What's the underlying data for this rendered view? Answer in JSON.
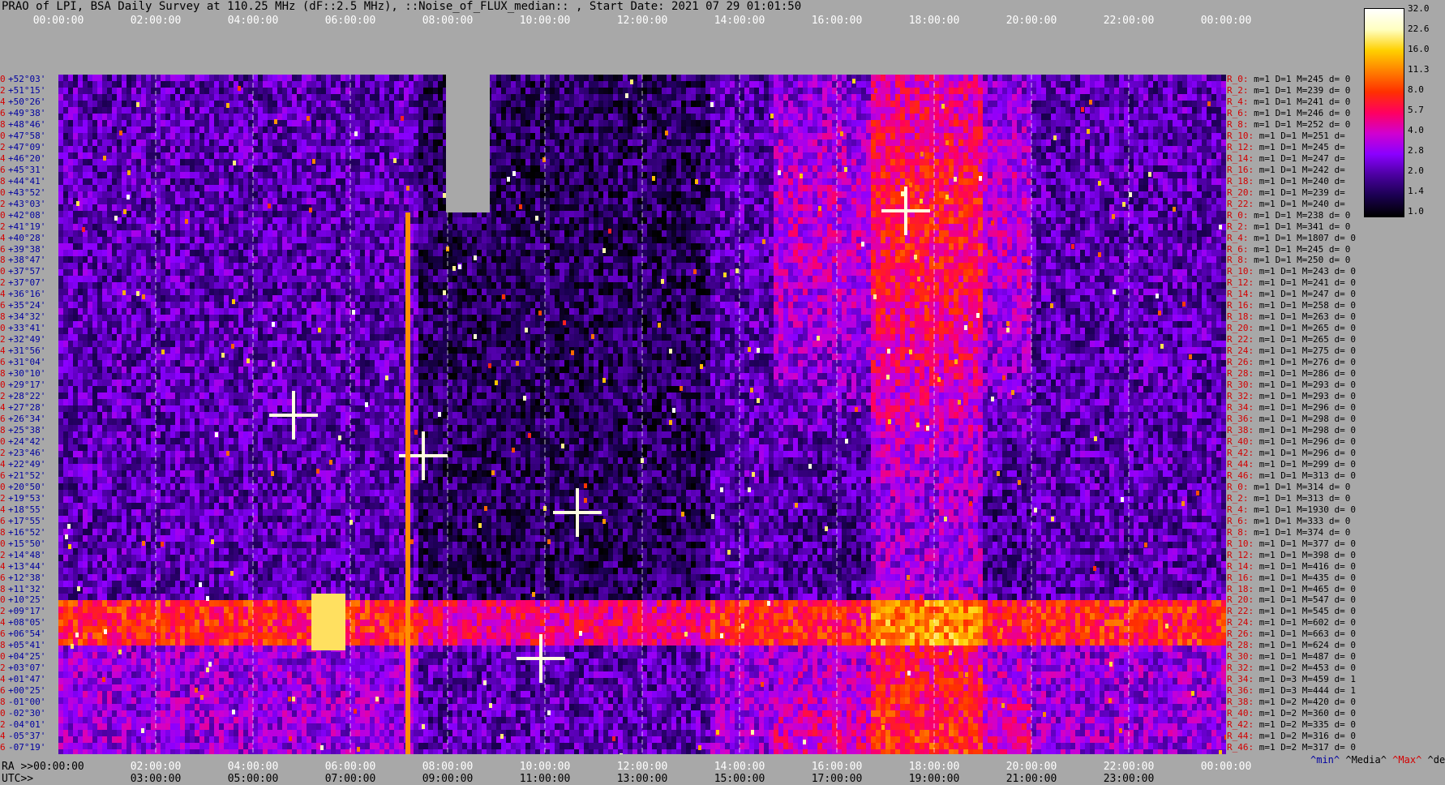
{
  "title": "PRAO of LPI, BSA Daily Survey at 110.25 MHz (dF::2.5 MHz), ::Noise_of_FLUX_median:: , Start Date: 2021 07 29 01:01:50",
  "chart_data": {
    "type": "heatmap",
    "x_top_ticks": [
      "00:00:00",
      "02:00:00",
      "04:00:00",
      "06:00:00",
      "08:00:00",
      "10:00:00",
      "12:00:00",
      "14:00:00",
      "16:00:00",
      "18:00:00",
      "20:00:00",
      "22:00:00",
      "00:00:00"
    ],
    "ra_bottom_ticks": [
      "02:00:00",
      "04:00:00",
      "06:00:00",
      "08:00:00",
      "10:00:00",
      "12:00:00",
      "14:00:00",
      "16:00:00",
      "18:00:00",
      "20:00:00",
      "22:00:00",
      "00:00:00"
    ],
    "ra_first_tick": "00:00:00",
    "utc_ticks": [
      "03:00:00",
      "05:00:00",
      "07:00:00",
      "09:00:00",
      "11:00:00",
      "13:00:00",
      "15:00:00",
      "17:00:00",
      "19:00:00",
      "21:00:00",
      "23:00:00"
    ],
    "ra_axis_label": "RA >>",
    "utc_axis_label": "UTC>>",
    "colorbar_ticks": [
      "32.0",
      "22.6",
      "16.0",
      "11.3",
      "8.0",
      "5.7",
      "4.0",
      "2.8",
      "2.0",
      "1.4",
      "1.0"
    ],
    "colorbar_range": [
      1.0,
      32.0
    ],
    "colorbar_scale": "log",
    "colormap": [
      "#000000",
      "#1a0050",
      "#4b00a0",
      "#8a00ff",
      "#d000d0",
      "#ff0060",
      "#ff3000",
      "#ff8000",
      "#ffd000",
      "#ffffc0",
      "#ffffff"
    ],
    "declinations": [
      {
        "i": "0",
        "d": "+52°03'"
      },
      {
        "i": "2",
        "d": "+51°15'"
      },
      {
        "i": "4",
        "d": "+50°26'"
      },
      {
        "i": "6",
        "d": "+49°38'"
      },
      {
        "i": "8",
        "d": "+48°46'"
      },
      {
        "i": "10",
        "d": "+47°58'"
      },
      {
        "i": "12",
        "d": "+47°09'"
      },
      {
        "i": "14",
        "d": "+46°20'"
      },
      {
        "i": "16",
        "d": "+45°31'"
      },
      {
        "i": "18",
        "d": "+44°41'"
      },
      {
        "i": "20",
        "d": "+43°52'"
      },
      {
        "i": "22",
        "d": "+43°03'"
      },
      {
        "i": "0",
        "d": "+42°08'"
      },
      {
        "i": "2",
        "d": "+41°19'"
      },
      {
        "i": "4",
        "d": "+40°28'"
      },
      {
        "i": "6",
        "d": "+39°38'"
      },
      {
        "i": "8",
        "d": "+38°47'"
      },
      {
        "i": "10",
        "d": "+37°57'"
      },
      {
        "i": "12",
        "d": "+37°07'"
      },
      {
        "i": "14",
        "d": "+36°16'"
      },
      {
        "i": "16",
        "d": "+35°24'"
      },
      {
        "i": "18",
        "d": "+34°32'"
      },
      {
        "i": "20",
        "d": "+33°41'"
      },
      {
        "i": "22",
        "d": "+32°49'"
      },
      {
        "i": "24",
        "d": "+31°56'"
      },
      {
        "i": "26",
        "d": "+31°04'"
      },
      {
        "i": "28",
        "d": "+30°10'"
      },
      {
        "i": "30",
        "d": "+29°17'"
      },
      {
        "i": "32",
        "d": "+28°22'"
      },
      {
        "i": "34",
        "d": "+27°28'"
      },
      {
        "i": "36",
        "d": "+26°34'"
      },
      {
        "i": "38",
        "d": "+25°38'"
      },
      {
        "i": "40",
        "d": "+24°42'"
      },
      {
        "i": "42",
        "d": "+23°46'"
      },
      {
        "i": "44",
        "d": "+22°49'"
      },
      {
        "i": "46",
        "d": "+21°52'"
      },
      {
        "i": "0",
        "d": "+20°50'"
      },
      {
        "i": "2",
        "d": "+19°53'"
      },
      {
        "i": "4",
        "d": "+18°55'"
      },
      {
        "i": "6",
        "d": "+17°55'"
      },
      {
        "i": "8",
        "d": "+16°52'"
      },
      {
        "i": "10",
        "d": "+15°50'"
      },
      {
        "i": "12",
        "d": "+14°48'"
      },
      {
        "i": "14",
        "d": "+13°44'"
      },
      {
        "i": "16",
        "d": "+12°38'"
      },
      {
        "i": "18",
        "d": "+11°32'"
      },
      {
        "i": "20",
        "d": "+10°25'"
      },
      {
        "i": "22",
        "d": "+09°17'"
      },
      {
        "i": "24",
        "d": "+08°05'"
      },
      {
        "i": "26",
        "d": "+06°54'"
      },
      {
        "i": "28",
        "d": "+05°41'"
      },
      {
        "i": "30",
        "d": "+04°25'"
      },
      {
        "i": "32",
        "d": "+03°07'"
      },
      {
        "i": "34",
        "d": "+01°47'"
      },
      {
        "i": "36",
        "d": "+00°25'"
      },
      {
        "i": "38",
        "d": "-01°00'"
      },
      {
        "i": "40",
        "d": "-02°30'"
      },
      {
        "i": "42",
        "d": "-04°01'"
      },
      {
        "i": "44",
        "d": "-05°37'"
      },
      {
        "i": "46",
        "d": "-07°19'"
      }
    ],
    "row_stats": [
      {
        "r": "R_0:",
        "m": "1",
        "D": "1",
        "M": "245",
        "dv": "0"
      },
      {
        "r": "R_2:",
        "m": "1",
        "D": "1",
        "M": "239",
        "dv": "0"
      },
      {
        "r": "R_4:",
        "m": "1",
        "D": "1",
        "M": "241",
        "dv": "0"
      },
      {
        "r": "R_6:",
        "m": "1",
        "D": "1",
        "M": "246",
        "dv": "0"
      },
      {
        "r": "R_8:",
        "m": "1",
        "D": "1",
        "M": "252",
        "dv": "0"
      },
      {
        "r": "R_10:",
        "m": "1",
        "D": "1",
        "M": "251",
        "dv": ""
      },
      {
        "r": "R_12:",
        "m": "1",
        "D": "1",
        "M": "245",
        "dv": ""
      },
      {
        "r": "R_14:",
        "m": "1",
        "D": "1",
        "M": "247",
        "dv": ""
      },
      {
        "r": "R_16:",
        "m": "1",
        "D": "1",
        "M": "242",
        "dv": ""
      },
      {
        "r": "R_18:",
        "m": "1",
        "D": "1",
        "M": "240",
        "dv": ""
      },
      {
        "r": "R_20:",
        "m": "1",
        "D": "1",
        "M": "239",
        "dv": ""
      },
      {
        "r": "R_22:",
        "m": "1",
        "D": "1",
        "M": "240",
        "dv": ""
      },
      {
        "r": "R_0:",
        "m": "1",
        "D": "1",
        "M": "238",
        "dv": "0"
      },
      {
        "r": "R_2:",
        "m": "1",
        "D": "1",
        "M": "341",
        "dv": "0"
      },
      {
        "r": "R_4:",
        "m": "1",
        "D": "1",
        "M": "1807",
        "dv": "0"
      },
      {
        "r": "R_6:",
        "m": "1",
        "D": "1",
        "M": "245",
        "dv": "0"
      },
      {
        "r": "R_8:",
        "m": "1",
        "D": "1",
        "M": "250",
        "dv": "0"
      },
      {
        "r": "R_10:",
        "m": "1",
        "D": "1",
        "M": "243",
        "dv": "0"
      },
      {
        "r": "R_12:",
        "m": "1",
        "D": "1",
        "M": "241",
        "dv": "0"
      },
      {
        "r": "R_14:",
        "m": "1",
        "D": "1",
        "M": "247",
        "dv": "0"
      },
      {
        "r": "R_16:",
        "m": "1",
        "D": "1",
        "M": "258",
        "dv": "0"
      },
      {
        "r": "R_18:",
        "m": "1",
        "D": "1",
        "M": "263",
        "dv": "0"
      },
      {
        "r": "R_20:",
        "m": "1",
        "D": "1",
        "M": "265",
        "dv": "0"
      },
      {
        "r": "R_22:",
        "m": "1",
        "D": "1",
        "M": "265",
        "dv": "0"
      },
      {
        "r": "R_24:",
        "m": "1",
        "D": "1",
        "M": "275",
        "dv": "0"
      },
      {
        "r": "R_26:",
        "m": "1",
        "D": "1",
        "M": "276",
        "dv": "0"
      },
      {
        "r": "R_28:",
        "m": "1",
        "D": "1",
        "M": "286",
        "dv": "0"
      },
      {
        "r": "R_30:",
        "m": "1",
        "D": "1",
        "M": "293",
        "dv": "0"
      },
      {
        "r": "R_32:",
        "m": "1",
        "D": "1",
        "M": "293",
        "dv": "0"
      },
      {
        "r": "R_34:",
        "m": "1",
        "D": "1",
        "M": "296",
        "dv": "0"
      },
      {
        "r": "R_36:",
        "m": "1",
        "D": "1",
        "M": "298",
        "dv": "0"
      },
      {
        "r": "R_38:",
        "m": "1",
        "D": "1",
        "M": "298",
        "dv": "0"
      },
      {
        "r": "R_40:",
        "m": "1",
        "D": "1",
        "M": "296",
        "dv": "0"
      },
      {
        "r": "R_42:",
        "m": "1",
        "D": "1",
        "M": "296",
        "dv": "0"
      },
      {
        "r": "R_44:",
        "m": "1",
        "D": "1",
        "M": "299",
        "dv": "0"
      },
      {
        "r": "R_46:",
        "m": "1",
        "D": "1",
        "M": "313",
        "dv": "0"
      },
      {
        "r": "R_0:",
        "m": "1",
        "D": "1",
        "M": "314",
        "dv": "0"
      },
      {
        "r": "R_2:",
        "m": "1",
        "D": "1",
        "M": "313",
        "dv": "0"
      },
      {
        "r": "R_4:",
        "m": "1",
        "D": "1",
        "M": "1930",
        "dv": "0"
      },
      {
        "r": "R_6:",
        "m": "1",
        "D": "1",
        "M": "333",
        "dv": "0"
      },
      {
        "r": "R_8:",
        "m": "1",
        "D": "1",
        "M": "374",
        "dv": "0"
      },
      {
        "r": "R_10:",
        "m": "1",
        "D": "1",
        "M": "377",
        "dv": "0"
      },
      {
        "r": "R_12:",
        "m": "1",
        "D": "1",
        "M": "398",
        "dv": "0"
      },
      {
        "r": "R_14:",
        "m": "1",
        "D": "1",
        "M": "416",
        "dv": "0"
      },
      {
        "r": "R_16:",
        "m": "1",
        "D": "1",
        "M": "435",
        "dv": "0"
      },
      {
        "r": "R_18:",
        "m": "1",
        "D": "1",
        "M": "465",
        "dv": "0"
      },
      {
        "r": "R_20:",
        "m": "1",
        "D": "1",
        "M": "547",
        "dv": "0"
      },
      {
        "r": "R_22:",
        "m": "1",
        "D": "1",
        "M": "545",
        "dv": "0"
      },
      {
        "r": "R_24:",
        "m": "1",
        "D": "1",
        "M": "602",
        "dv": "0"
      },
      {
        "r": "R_26:",
        "m": "1",
        "D": "1",
        "M": "663",
        "dv": "0"
      },
      {
        "r": "R_28:",
        "m": "1",
        "D": "1",
        "M": "624",
        "dv": "0"
      },
      {
        "r": "R_30:",
        "m": "1",
        "D": "1",
        "M": "487",
        "dv": "0"
      },
      {
        "r": "R_32:",
        "m": "1",
        "D": "2",
        "M": "453",
        "dv": "0"
      },
      {
        "r": "R_34:",
        "m": "1",
        "D": "3",
        "M": "459",
        "dv": "1"
      },
      {
        "r": "R_36:",
        "m": "1",
        "D": "3",
        "M": "444",
        "dv": "1"
      },
      {
        "r": "R_38:",
        "m": "1",
        "D": "2",
        "M": "420",
        "dv": "0"
      },
      {
        "r": "R_40:",
        "m": "1",
        "D": "2",
        "M": "360",
        "dv": "0"
      },
      {
        "r": "R_42:",
        "m": "1",
        "D": "2",
        "M": "335",
        "dv": "0"
      },
      {
        "r": "R_44:",
        "m": "1",
        "D": "2",
        "M": "316",
        "dv": "0"
      },
      {
        "r": "R_46:",
        "m": "1",
        "D": "2",
        "M": "317",
        "dv": "0"
      }
    ],
    "legend_labels": {
      "min": "^min^",
      "median": "^Media^",
      "max": "^Max^",
      "dev": "^devia^"
    }
  }
}
